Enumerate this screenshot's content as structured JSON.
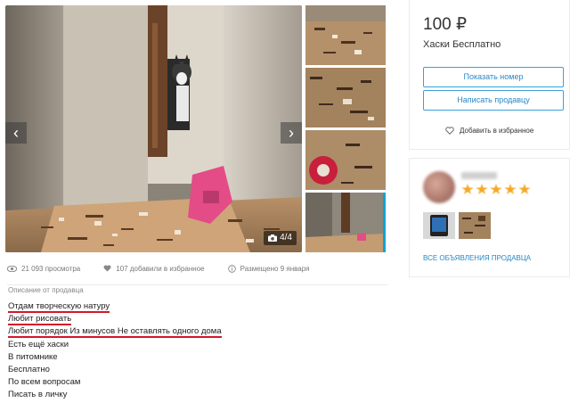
{
  "gallery": {
    "counter": "4/4",
    "prev_icon": "chevron-left-icon",
    "next_icon": "chevron-right-icon",
    "camera_icon": "camera-icon"
  },
  "stats": {
    "views": "21 093 просмотра",
    "favorites": "107 добавили в избранное",
    "posted": "Размещено 9 января"
  },
  "description": {
    "heading": "Описание от продавца",
    "lines": [
      "Отдам творческую натуру",
      "Любит рисовать",
      "Любит порядок Из минусов Не оставлять одного дома",
      "Есть ещё хаски",
      "В питомнике",
      "Бесплатно",
      "По всем вопросам",
      "Писать в личку"
    ],
    "highlighted_lines": [
      0,
      1,
      2
    ],
    "highlight_color": "#d3182b"
  },
  "listing": {
    "price": "100 ₽",
    "title": "Хаски Бесплатно",
    "show_number_label": "Показать номер",
    "write_seller_label": "Написать продавцу",
    "favorite_label": "Добавить в избранное"
  },
  "seller": {
    "rating_stars": 5,
    "all_ads_label": "ВСЕ ОБЪЯВЛЕНИЯ ПРОДАВЦА"
  },
  "colors": {
    "accent": "#2688c9",
    "star": "#f6a726"
  }
}
